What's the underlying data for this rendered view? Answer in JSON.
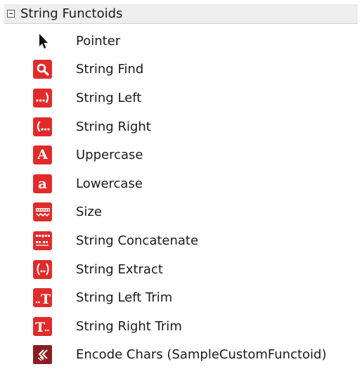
{
  "toolbox": {
    "group": {
      "title": "String Functoids",
      "expanded": true
    },
    "items": [
      {
        "label": "Pointer",
        "icon": "pointer-arrow-icon"
      },
      {
        "label": "String Find",
        "icon": "magnifier-icon"
      },
      {
        "label": "String Left",
        "icon": "string-left-icon"
      },
      {
        "label": "String Right",
        "icon": "string-right-icon"
      },
      {
        "label": "Uppercase",
        "icon": "uppercase-a-icon"
      },
      {
        "label": "Lowercase",
        "icon": "lowercase-a-icon"
      },
      {
        "label": "Size",
        "icon": "ruler-size-icon"
      },
      {
        "label": "String Concatenate",
        "icon": "concatenate-icon"
      },
      {
        "label": "String Extract",
        "icon": "extract-icon"
      },
      {
        "label": "String Left Trim",
        "icon": "left-trim-icon"
      },
      {
        "label": "String Right Trim",
        "icon": "right-trim-icon"
      },
      {
        "label": "Encode Chars (SampleCustomFunctoid)",
        "icon": "encode-chars-icon"
      }
    ]
  },
  "colors": {
    "header_bg": "#eeeeee",
    "icon_red": "#e12b2b",
    "icon_dark_red": "#8a1e22",
    "text": "#1a1a1a"
  }
}
